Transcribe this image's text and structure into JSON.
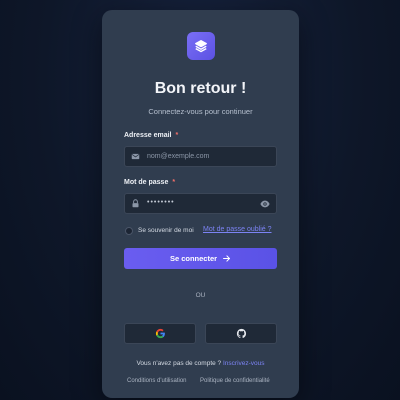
{
  "card": {
    "title": "Bon retour !",
    "subtitle": "Connectez-vous pour continuer"
  },
  "email": {
    "label": "Adresse email",
    "required_mark": "*",
    "placeholder": "nom@exemple.com",
    "icon": "mail-icon"
  },
  "password": {
    "label": "Mot de passe",
    "required_mark": "*",
    "value_masked": "••••••••",
    "icon": "lock-icon",
    "toggle_icon": "eye-icon"
  },
  "remember": {
    "label": "Se souvenir de moi",
    "checked": false
  },
  "forgot": {
    "label": "Mot de passe oublié ?"
  },
  "submit": {
    "label": "Se connecter",
    "icon": "arrow-right-icon"
  },
  "divider": {
    "label": "OU"
  },
  "social": {
    "google_icon": "google-icon",
    "github_icon": "github-icon"
  },
  "signup": {
    "prompt": "Vous n'avez pas de compte ?",
    "link": "Inscrivez-vous"
  },
  "footer": {
    "terms": "Conditions d'utilisation",
    "privacy": "Politique de confidentialité"
  },
  "colors": {
    "accent": "#6a5df0",
    "link": "#7c83f4",
    "card": "#303d4f",
    "required": "#f4706a"
  }
}
